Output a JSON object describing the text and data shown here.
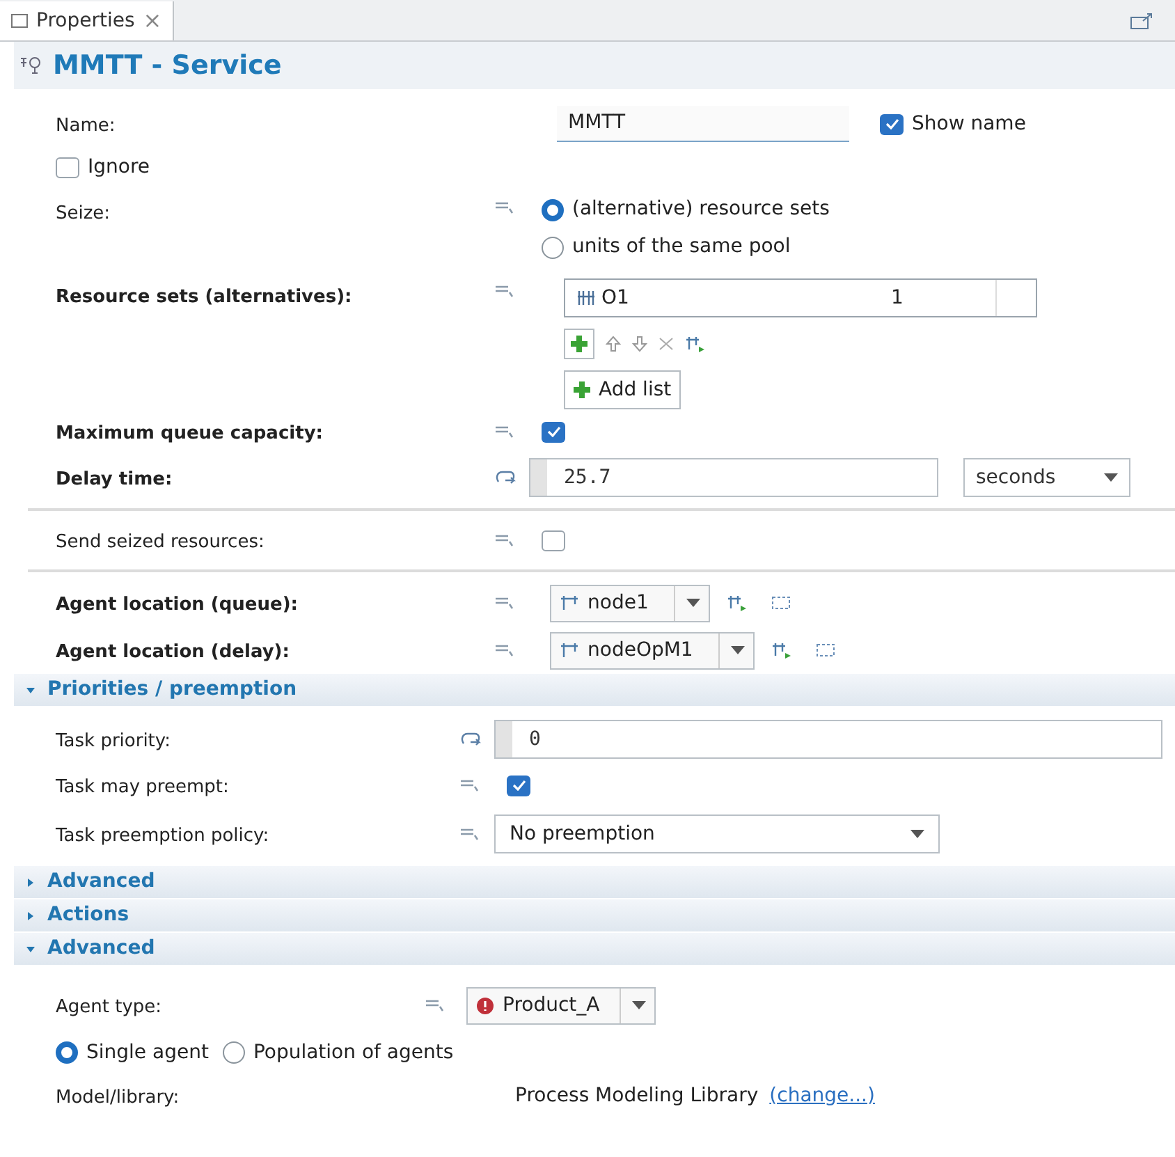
{
  "tab": {
    "label": "Properties",
    "selected": true,
    "close": "×"
  },
  "title": "MMTT - Service",
  "sections": [
    {
      "rows": [
        {
          "kind": "name",
          "label": "Name:",
          "value": "MMTT",
          "option": {
            "label": "Show name",
            "checked": true
          }
        },
        {
          "kind": "inline-check",
          "label": "Ignore",
          "checked": false
        },
        {
          "kind": "radios",
          "label": "Seize:",
          "options": [
            {
              "label": "(alternative) resource sets",
              "selected": true
            },
            {
              "label": "units of the same pool",
              "selected": false
            }
          ]
        },
        {
          "kind": "resources",
          "label": "Resource sets (alternatives):",
          "bold": true,
          "entries": [
            {
              "name": "O1",
              "count": "1"
            }
          ],
          "add_label": "Add list"
        },
        {
          "kind": "checkbox",
          "label": "Maximum queue capacity:",
          "bold": true,
          "checked": true
        },
        {
          "kind": "code",
          "label": "Delay time:",
          "bold": true,
          "value": "25.7",
          "unit": "seconds"
        },
        {
          "kind": "divider"
        },
        {
          "kind": "checkbox",
          "label": "Send seized resources:",
          "bold": false,
          "checked": false
        },
        {
          "kind": "divider"
        },
        {
          "kind": "location",
          "label": "Agent location (queue):",
          "bold": true,
          "value": "node1"
        },
        {
          "kind": "location",
          "label": "Agent location (delay):",
          "bold": true,
          "value": "nodeOpM1"
        }
      ]
    },
    {
      "header": "Priorities / preemption",
      "expanded": true,
      "rows": [
        {
          "kind": "code",
          "label": "Task priority:",
          "bold": false,
          "value": "0"
        },
        {
          "kind": "checkbox",
          "label": "Task may preempt:",
          "bold": false,
          "checked": true
        },
        {
          "kind": "select",
          "label": "Task preemption policy:",
          "bold": false,
          "value": "No preemption"
        }
      ]
    },
    {
      "header": "Advanced",
      "expanded": false
    },
    {
      "header": "Actions",
      "expanded": false
    },
    {
      "header": "Advanced",
      "expanded": true,
      "rows": [
        {
          "kind": "agent-type",
          "label": "Agent type:",
          "bold": false,
          "value": "Product_A"
        },
        {
          "kind": "inline-radios",
          "options": [
            {
              "label": "Single agent",
              "selected": true
            },
            {
              "label": "Population of agents",
              "selected": false
            }
          ]
        },
        {
          "kind": "link-text",
          "label": "Model/library:",
          "value": "Process Modeling Library",
          "link": "(change...)"
        }
      ]
    }
  ]
}
